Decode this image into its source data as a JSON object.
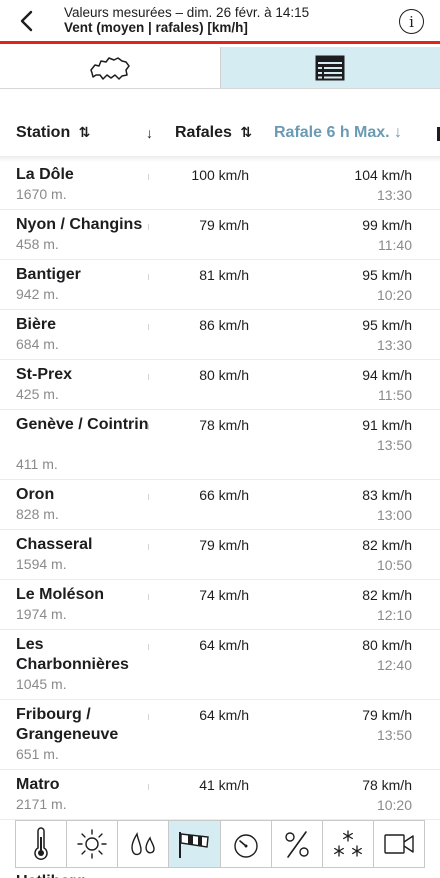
{
  "header": {
    "line1": "Valeurs mesurées – dim. 26 févr. à 14:15",
    "line2": "Vent (moyen | rafales) [km/h]",
    "info_label": "i"
  },
  "tabs": [
    {
      "name": "map",
      "icon": "switzerland-map-icon",
      "active": false
    },
    {
      "name": "list",
      "icon": "list-icon",
      "active": true
    }
  ],
  "columns": {
    "station": "Station",
    "station_sort": "⇅",
    "sort_down": "↓",
    "gusts": "Rafales",
    "gusts_sort": "⇅",
    "max6h": "Rafale 6 h Max. ↓"
  },
  "stations": [
    {
      "name": "La Dôle",
      "altitude": "1670 m.",
      "gust": "100 km/h",
      "max": "104 km/h",
      "time": "13:30"
    },
    {
      "name": "Nyon / Changins",
      "altitude": "458 m.",
      "gust": "79 km/h",
      "max": "99 km/h",
      "time": "11:40"
    },
    {
      "name": "Bantiger",
      "altitude": "942 m.",
      "gust": "81 km/h",
      "max": "95 km/h",
      "time": "10:20"
    },
    {
      "name": "Bière",
      "altitude": "684 m.",
      "gust": "86 km/h",
      "max": "95 km/h",
      "time": "13:30"
    },
    {
      "name": "St-Prex",
      "altitude": "425 m.",
      "gust": "80 km/h",
      "max": "94 km/h",
      "time": "11:50"
    },
    {
      "name": "Genève / Cointrin",
      "altitude": "411 m.",
      "gust": "78 km/h",
      "max": "91 km/h",
      "time": "13:50"
    },
    {
      "name": "Oron",
      "altitude": "828 m.",
      "gust": "66 km/h",
      "max": "83 km/h",
      "time": "13:00"
    },
    {
      "name": "Chasseral",
      "altitude": "1594 m.",
      "gust": "79 km/h",
      "max": "82 km/h",
      "time": "10:50"
    },
    {
      "name": "Le Moléson",
      "altitude": "1974 m.",
      "gust": "74 km/h",
      "max": "82 km/h",
      "time": "12:10"
    },
    {
      "name": "Les Charbonnières",
      "altitude": "1045 m.",
      "gust": "64 km/h",
      "max": "80 km/h",
      "time": "12:40"
    },
    {
      "name": "Fribourg / Grangeneuve",
      "altitude": "651 m.",
      "gust": "64 km/h",
      "max": "79 km/h",
      "time": "13:50"
    },
    {
      "name": "Matro",
      "altitude": "2171 m.",
      "gust": "41 km/h",
      "max": "78 km/h",
      "time": "10:20"
    }
  ],
  "toolbar": [
    {
      "name": "temperature",
      "icon": "thermometer-icon",
      "active": false
    },
    {
      "name": "sunshine",
      "icon": "sun-icon",
      "active": false
    },
    {
      "name": "precipitation",
      "icon": "raindrops-icon",
      "active": false
    },
    {
      "name": "wind",
      "icon": "windsock-icon",
      "active": true
    },
    {
      "name": "pressure",
      "icon": "gauge-icon",
      "active": false
    },
    {
      "name": "humidity",
      "icon": "humidity-percent-icon",
      "active": false
    },
    {
      "name": "snow",
      "icon": "snowflakes-icon",
      "active": false
    },
    {
      "name": "webcam",
      "icon": "video-camera-icon",
      "active": false
    }
  ],
  "peek_text": "Uetliberg",
  "colors": {
    "accent_red": "#e2231a",
    "active_bg": "#d6ecf3",
    "sort_blue": "#6b9bb3"
  }
}
